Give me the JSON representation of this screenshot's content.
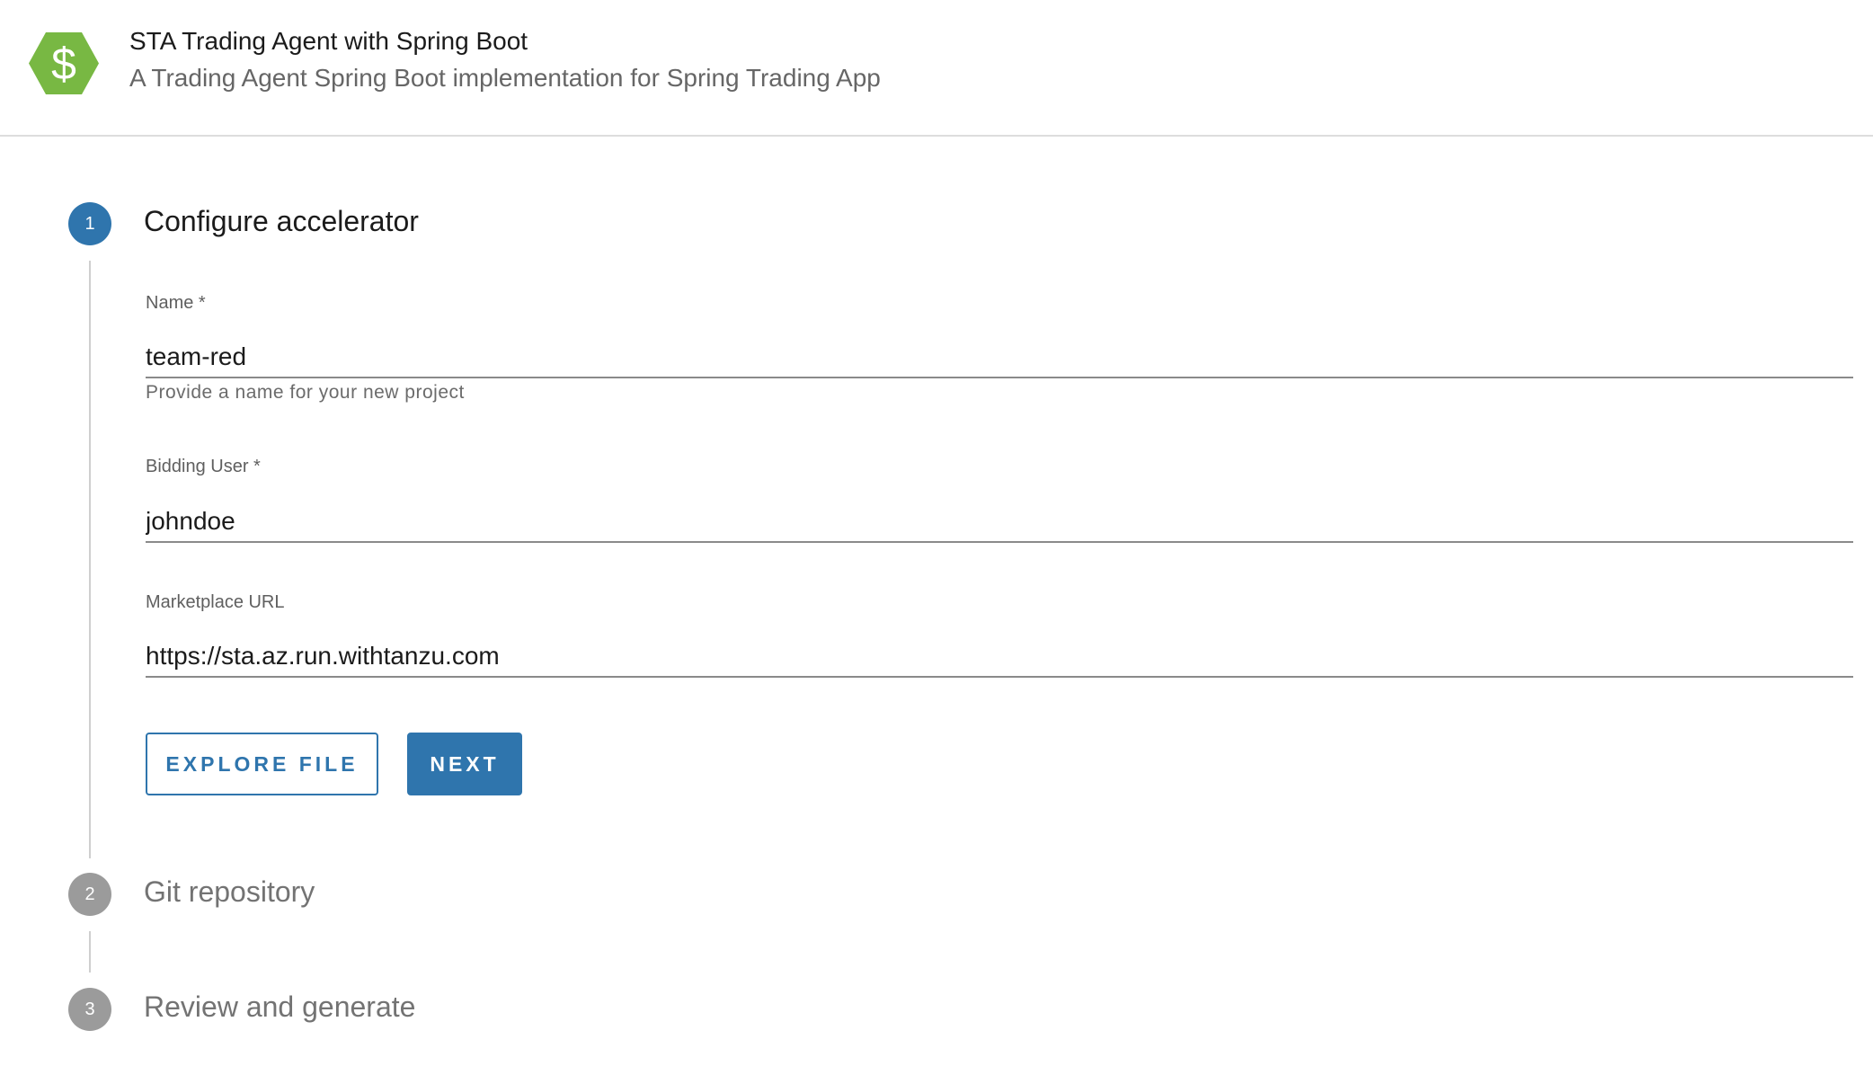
{
  "header": {
    "logo_icon": "dollar-hexagon-icon",
    "title": "STA Trading Agent with Spring Boot",
    "subtitle": "A Trading Agent Spring Boot implementation for Spring Trading App"
  },
  "steps": [
    {
      "number": "1",
      "title": "Configure accelerator",
      "state": "active"
    },
    {
      "number": "2",
      "title": "Git repository",
      "state": "inactive"
    },
    {
      "number": "3",
      "title": "Review and generate",
      "state": "inactive"
    }
  ],
  "form": {
    "name": {
      "label": "Name *",
      "value": "team-red",
      "help": "Provide a name for your new project"
    },
    "bidding_user": {
      "label": "Bidding User *",
      "value": "johndoe"
    },
    "marketplace_url": {
      "label": "Marketplace URL",
      "value": "https://sta.az.run.withtanzu.com"
    }
  },
  "buttons": {
    "explore_file": "EXPLORE FILE",
    "next": "NEXT"
  },
  "colors": {
    "accent": "#2f75ad",
    "logo_green": "#78b843",
    "inactive_step": "#9b9b9b"
  }
}
